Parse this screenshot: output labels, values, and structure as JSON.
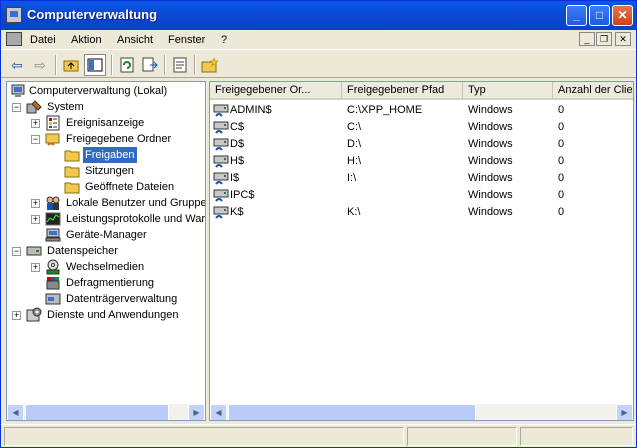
{
  "window": {
    "title": "Computerverwaltung"
  },
  "titlebar": {
    "minimize": "_",
    "maximize": "□",
    "close": "✕"
  },
  "menubar": {
    "items": [
      "Datei",
      "Aktion",
      "Ansicht",
      "Fenster",
      "?"
    ]
  },
  "mdi": {
    "minimize": "_",
    "restore": "❐",
    "close": "✕"
  },
  "toolbar": {
    "icons": [
      "back-arrow-icon",
      "forward-arrow-icon",
      "up-folder-icon",
      "show-hide-tree-icon",
      "refresh-icon",
      "export-list-icon",
      "properties-icon",
      "new-share-icon"
    ]
  },
  "tree": {
    "items": [
      {
        "label": "Computerverwaltung (Lokal)",
        "icon": "computer-management-icon"
      },
      {
        "label": "System",
        "icon": "system-tools-icon"
      },
      {
        "label": "Ereignisanzeige",
        "icon": "event-viewer-icon"
      },
      {
        "label": "Freigegebene Ordner",
        "icon": "shared-folders-icon"
      },
      {
        "label": "Freigaben",
        "icon": "folder-icon"
      },
      {
        "label": "Sitzungen",
        "icon": "folder-icon"
      },
      {
        "label": "Geöffnete Dateien",
        "icon": "folder-icon"
      },
      {
        "label": "Lokale Benutzer und Gruppen",
        "icon": "users-icon"
      },
      {
        "label": "Leistungsprotokolle und Warnungen",
        "icon": "performance-icon"
      },
      {
        "label": "Geräte-Manager",
        "icon": "device-manager-icon"
      },
      {
        "label": "Datenspeicher",
        "icon": "storage-icon"
      },
      {
        "label": "Wechselmedien",
        "icon": "removable-storage-icon"
      },
      {
        "label": "Defragmentierung",
        "icon": "defrag-icon"
      },
      {
        "label": "Datenträgerverwaltung",
        "icon": "disk-management-icon"
      },
      {
        "label": "Dienste und Anwendungen",
        "icon": "services-icon"
      }
    ]
  },
  "list": {
    "columns": [
      "Freigegebener Or...",
      "Freigegebener Pfad",
      "Typ",
      "Anzahl der Clien"
    ],
    "rows": [
      {
        "name": "ADMIN$",
        "path": "C:\\XPP_HOME",
        "type": "Windows",
        "clients": "0"
      },
      {
        "name": "C$",
        "path": "C:\\",
        "type": "Windows",
        "clients": "0"
      },
      {
        "name": "D$",
        "path": "D:\\",
        "type": "Windows",
        "clients": "0"
      },
      {
        "name": "H$",
        "path": "H:\\",
        "type": "Windows",
        "clients": "0"
      },
      {
        "name": "I$",
        "path": "I:\\",
        "type": "Windows",
        "clients": "0"
      },
      {
        "name": "IPC$",
        "path": "",
        "type": "Windows",
        "clients": "0"
      },
      {
        "name": "K$",
        "path": "K:\\",
        "type": "Windows",
        "clients": "0"
      }
    ]
  },
  "colors": {
    "titlebar": "#0A58E8",
    "selection": "#316AC5",
    "folder": "#F2C94C"
  }
}
